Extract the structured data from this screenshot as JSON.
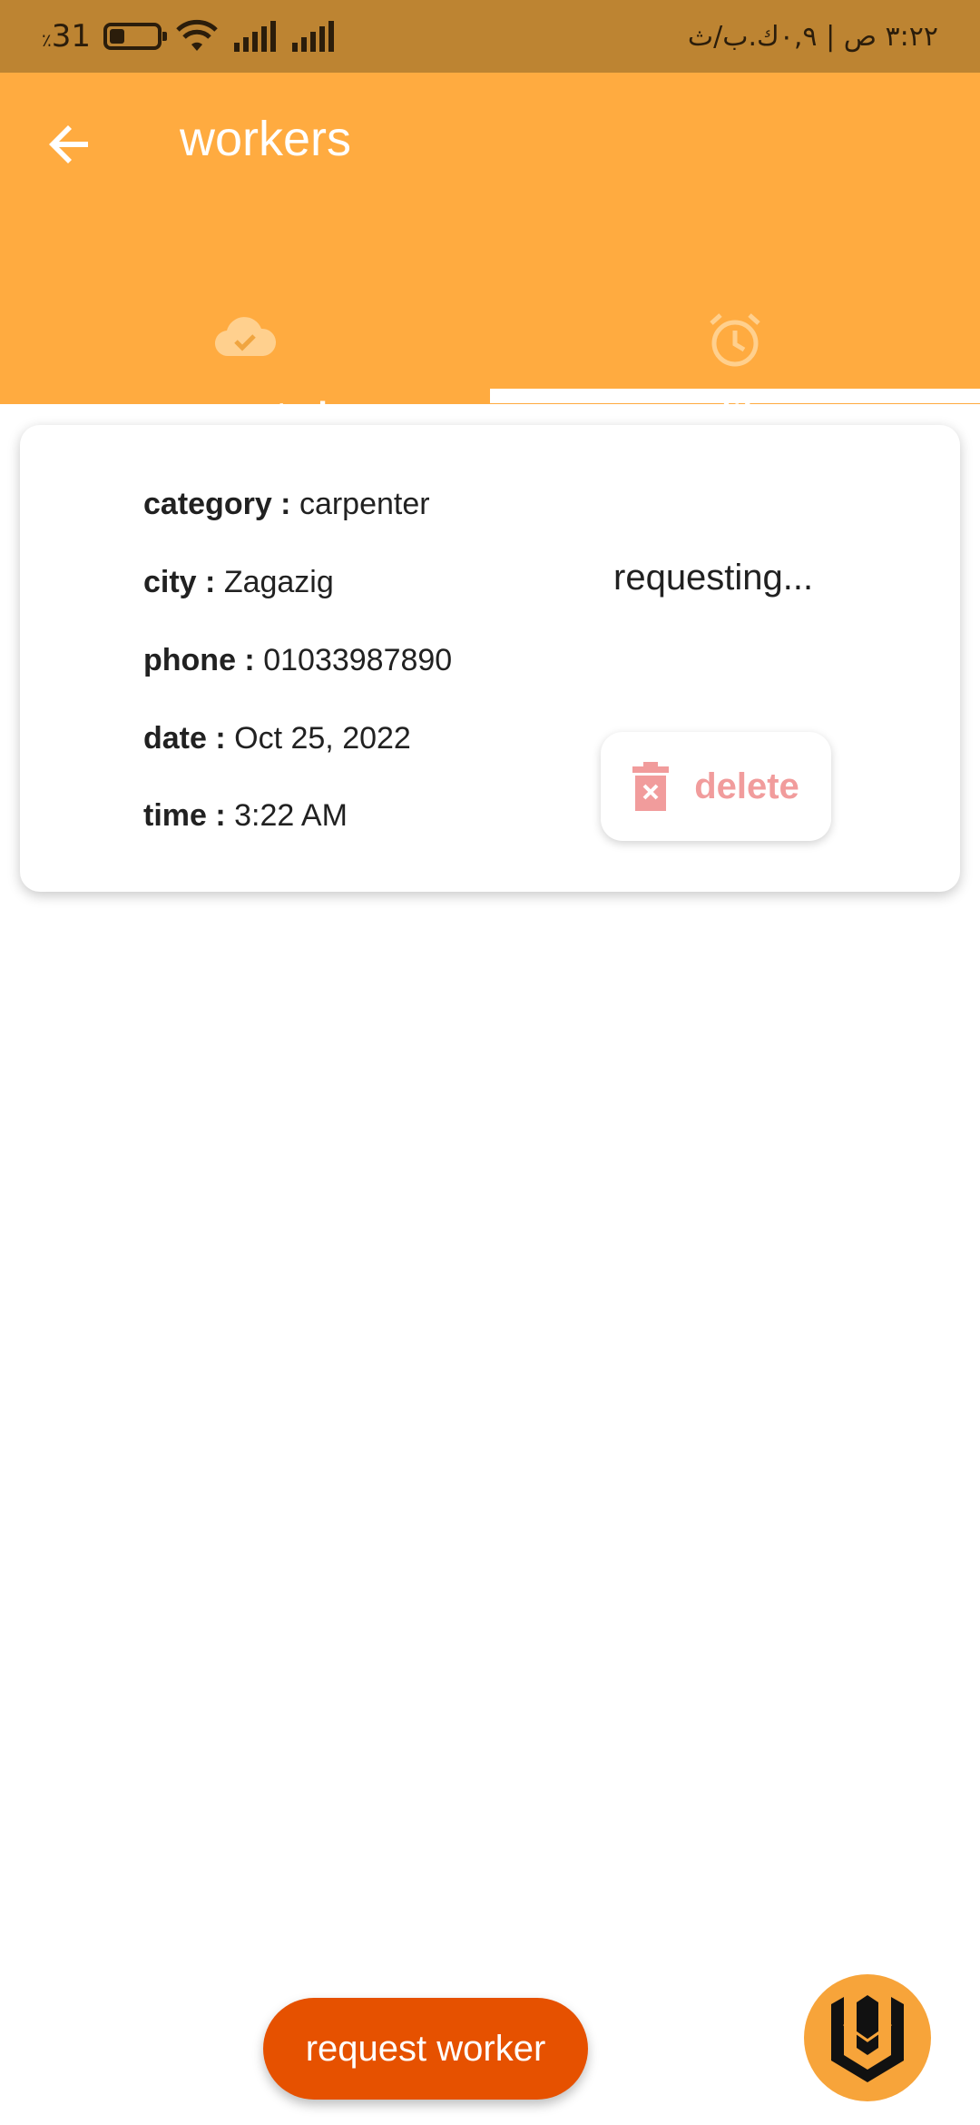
{
  "status_bar": {
    "battery_percent": "31",
    "battery_level": 0.31,
    "right_text": "٣:٢٢ ص | ٠,٩ك.ب/ث"
  },
  "app_bar": {
    "title": "workers",
    "back_icon": "arrow-back-icon",
    "background": "#ffab40"
  },
  "tabs": [
    {
      "label": "requested",
      "icon": "cloud-check-icon",
      "selected": true
    },
    {
      "label": "waiting",
      "icon": "alarm-clock-icon",
      "selected": false
    }
  ],
  "request_card": {
    "fields": [
      {
        "label": "category :",
        "value": "carpenter"
      },
      {
        "label": "city :",
        "value": "Zagazig"
      },
      {
        "label": "phone :",
        "value": "01033987890"
      },
      {
        "label": "date :",
        "value": "Oct 25, 2022"
      },
      {
        "label": "time :",
        "value": "3:22 AM"
      }
    ],
    "status": "requesting...",
    "delete_label": "delete",
    "delete_icon": "trash-icon"
  },
  "fab": {
    "request_label": "request worker",
    "request_color": "#e65100",
    "logo_icon": "app-logo-icon"
  }
}
